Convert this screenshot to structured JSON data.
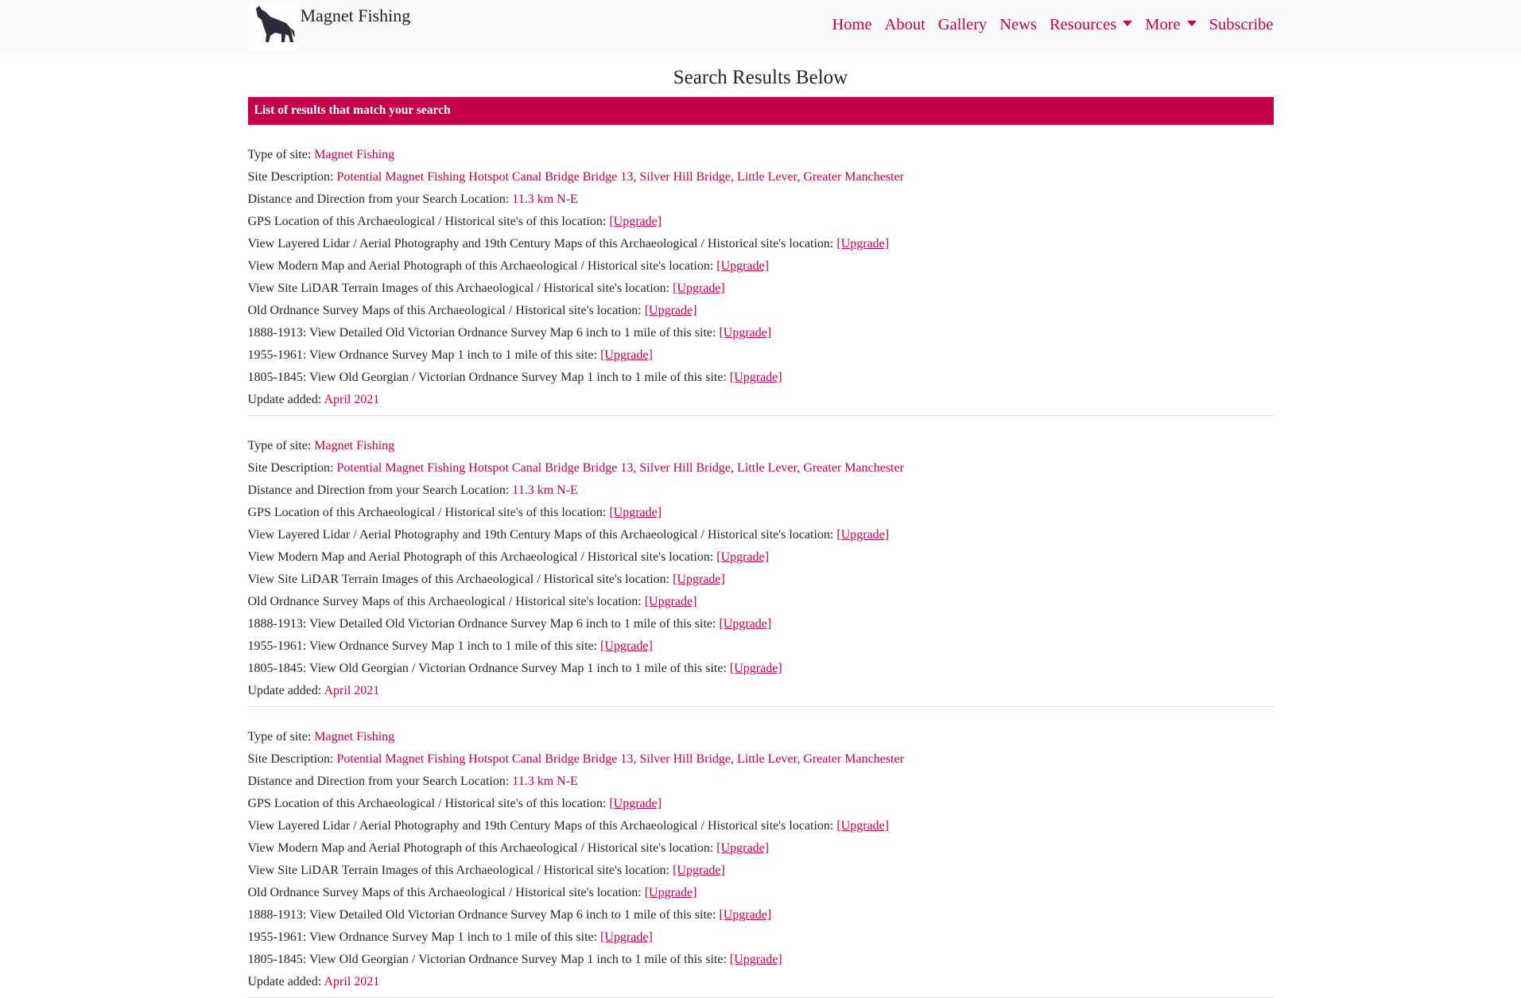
{
  "nav": {
    "brand": "Magnet Fishing",
    "items": [
      {
        "label": "Home",
        "dropdown": false
      },
      {
        "label": "About",
        "dropdown": false
      },
      {
        "label": "Gallery",
        "dropdown": false
      },
      {
        "label": "News",
        "dropdown": false
      },
      {
        "label": "Resources",
        "dropdown": true
      },
      {
        "label": "More",
        "dropdown": true
      },
      {
        "label": "Subscribe",
        "dropdown": false
      }
    ]
  },
  "page": {
    "title": "Search Results Below",
    "banner": "List of results that match your search"
  },
  "result": {
    "type_label": "Type of site:",
    "type_value": "Magnet Fishing",
    "desc_label": "Site Description:",
    "desc_value": "Potential Magnet Fishing Hotspot Canal Bridge Bridge 13, Silver Hill Bridge, Little Lever, Greater Manchester",
    "dist_label": "Distance and Direction from your Search Location:",
    "dist_value": "11.3 km N-E",
    "upgrade_rows": [
      "GPS Location of this Archaeological / Historical site's of this location:",
      "View Layered Lidar / Aerial Photography and 19th Century Maps of this Archaeological / Historical site's location:",
      "View Modern Map and Aerial Photograph of this Archaeological / Historical site's location:",
      "View Site LiDAR Terrain Images of this Archaeological / Historical site's location:",
      "Old Ordnance Survey Maps of this Archaeological / Historical site's location:",
      "1888-1913: View Detailed Old Victorian Ordnance Survey Map 6 inch to 1 mile of this site:",
      "1955-1961: View Ordnance Survey Map 1 inch to 1 mile of this site:",
      "1805-1845: View Old Georgian / Victorian Ordnance Survey Map 1 inch to 1 mile of this site:"
    ],
    "upgrade_link": "[Upgrade]",
    "update_label": "Update added:",
    "update_value": "April 2021"
  },
  "results_count_visible": 3
}
